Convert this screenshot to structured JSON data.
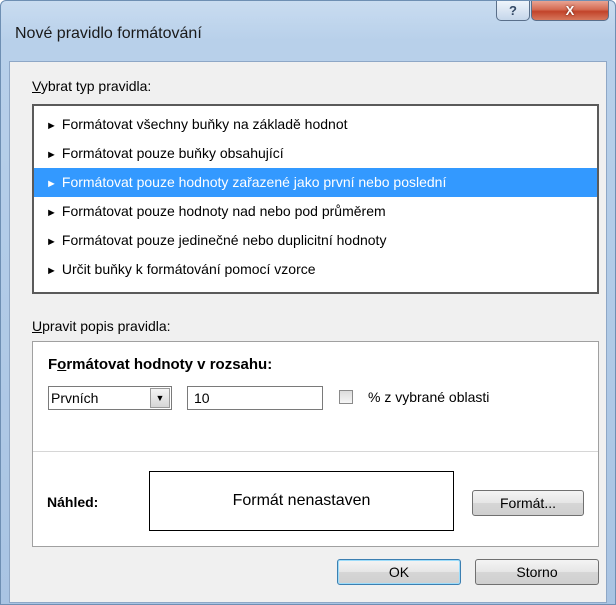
{
  "window": {
    "title": "Nové pravidlo formátování",
    "help_glyph": "?",
    "close_glyph": "X"
  },
  "select_type": {
    "label": "Vybrat typ pravidla:",
    "arrow_glyph": "►",
    "items": [
      "Formátovat všechny buňky na základě hodnot",
      "Formátovat pouze buňky obsahující",
      "Formátovat pouze hodnoty zařazené jako první nebo poslední",
      "Formátovat pouze hodnoty nad nebo pod průměrem",
      "Formátovat pouze jedinečné nebo duplicitní hodnoty",
      "Určit buňky k formátování pomocí vzorce"
    ],
    "selected_index": 2
  },
  "edit_rule": {
    "label": "Upravit popis pravidla:",
    "format_values_label": "Formátovat hodnoty v rozsahu:",
    "dropdown_value": "Prvních",
    "dropdown_arrow": "▼",
    "count_value": "10",
    "percent_checked": false,
    "percent_label": "% z vybrané oblasti",
    "preview_label": "Náhled:",
    "preview_text": "Formát nenastaven",
    "format_button": "Formát..."
  },
  "buttons": {
    "ok": "OK",
    "cancel": "Storno"
  },
  "colors": {
    "selection": "#3399ff",
    "close_button": "#c2432a",
    "title_gradient": "#b8d0ea"
  }
}
